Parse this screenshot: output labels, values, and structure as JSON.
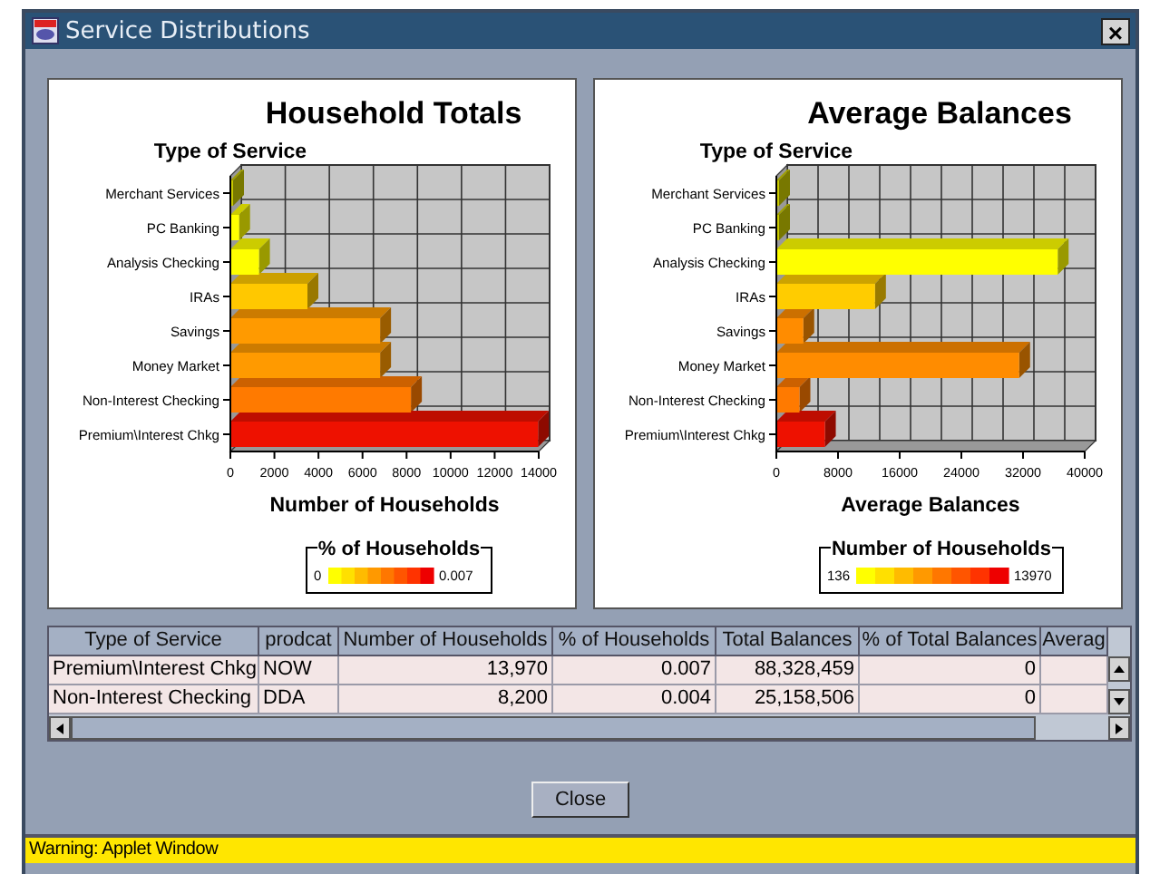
{
  "window": {
    "title": "Service Distributions",
    "close": "×"
  },
  "charts": [
    {
      "chart_data": {
        "type": "bar",
        "orientation": "horizontal",
        "title": "Household Totals",
        "ylabel": "Type of Service",
        "xlabel": "Number of Households",
        "categories": [
          "Merchant Services",
          "PC Banking",
          "Analysis Checking",
          "IRAs",
          "Savings",
          "Money Market",
          "Non-Interest Checking",
          "Premium\\Interest Chkg"
        ],
        "series": [
          {
            "values": [
              100,
              400,
              1300,
              3500,
              6800,
              6800,
              8200,
              13970
            ],
            "colors": [
              "#c8c800",
              "#ffff00",
              "#ffff00",
              "#ffc800",
              "#ff9a00",
              "#ff9a00",
              "#ff7a00",
              "#ee1100"
            ]
          }
        ],
        "xlim": [
          0,
          14000
        ],
        "xticks": [
          0,
          2000,
          4000,
          6000,
          8000,
          10000,
          12000,
          14000
        ]
      },
      "legend": {
        "title": "% of Households",
        "min": "0",
        "max": "0.007"
      }
    },
    {
      "chart_data": {
        "type": "bar",
        "orientation": "horizontal",
        "title": "Average Balances",
        "ylabel": "Type of Service",
        "xlabel": "Average Balances",
        "categories": [
          "Merchant Services",
          "PC Banking",
          "Analysis Checking",
          "IRAs",
          "Savings",
          "Money Market",
          "Non-Interest Checking",
          "Premium\\Interest Chkg"
        ],
        "series": [
          {
            "values": [
              0,
              0,
              36500,
              12800,
              3500,
              31500,
              3000,
              6300
            ],
            "colors": [
              "#c8c800",
              "#c8c800",
              "#ffff00",
              "#ffcc00",
              "#ff8c00",
              "#ff8c00",
              "#ff7a00",
              "#ee1100"
            ]
          }
        ],
        "xlim": [
          0,
          40000
        ],
        "xticks": [
          0,
          8000,
          16000,
          24000,
          32000,
          40000
        ]
      },
      "legend": {
        "title": "Number of Households",
        "min": "136",
        "max": "13970"
      }
    }
  ],
  "table": {
    "columns": [
      "Type of Service",
      "prodcat",
      "Number of Households",
      "% of Households",
      "Total Balances",
      "% of Total Balances",
      "Averag"
    ],
    "rows": [
      [
        "Premium\\Interest Chkg",
        "NOW",
        "13,970",
        "0.007",
        "88,328,459",
        "0"
      ],
      [
        "Non-Interest Checking",
        "DDA",
        "8,200",
        "0.004",
        "25,158,506",
        "0"
      ]
    ]
  },
  "buttons": [
    "Close"
  ],
  "status_bar": "Warning: Applet Window"
}
